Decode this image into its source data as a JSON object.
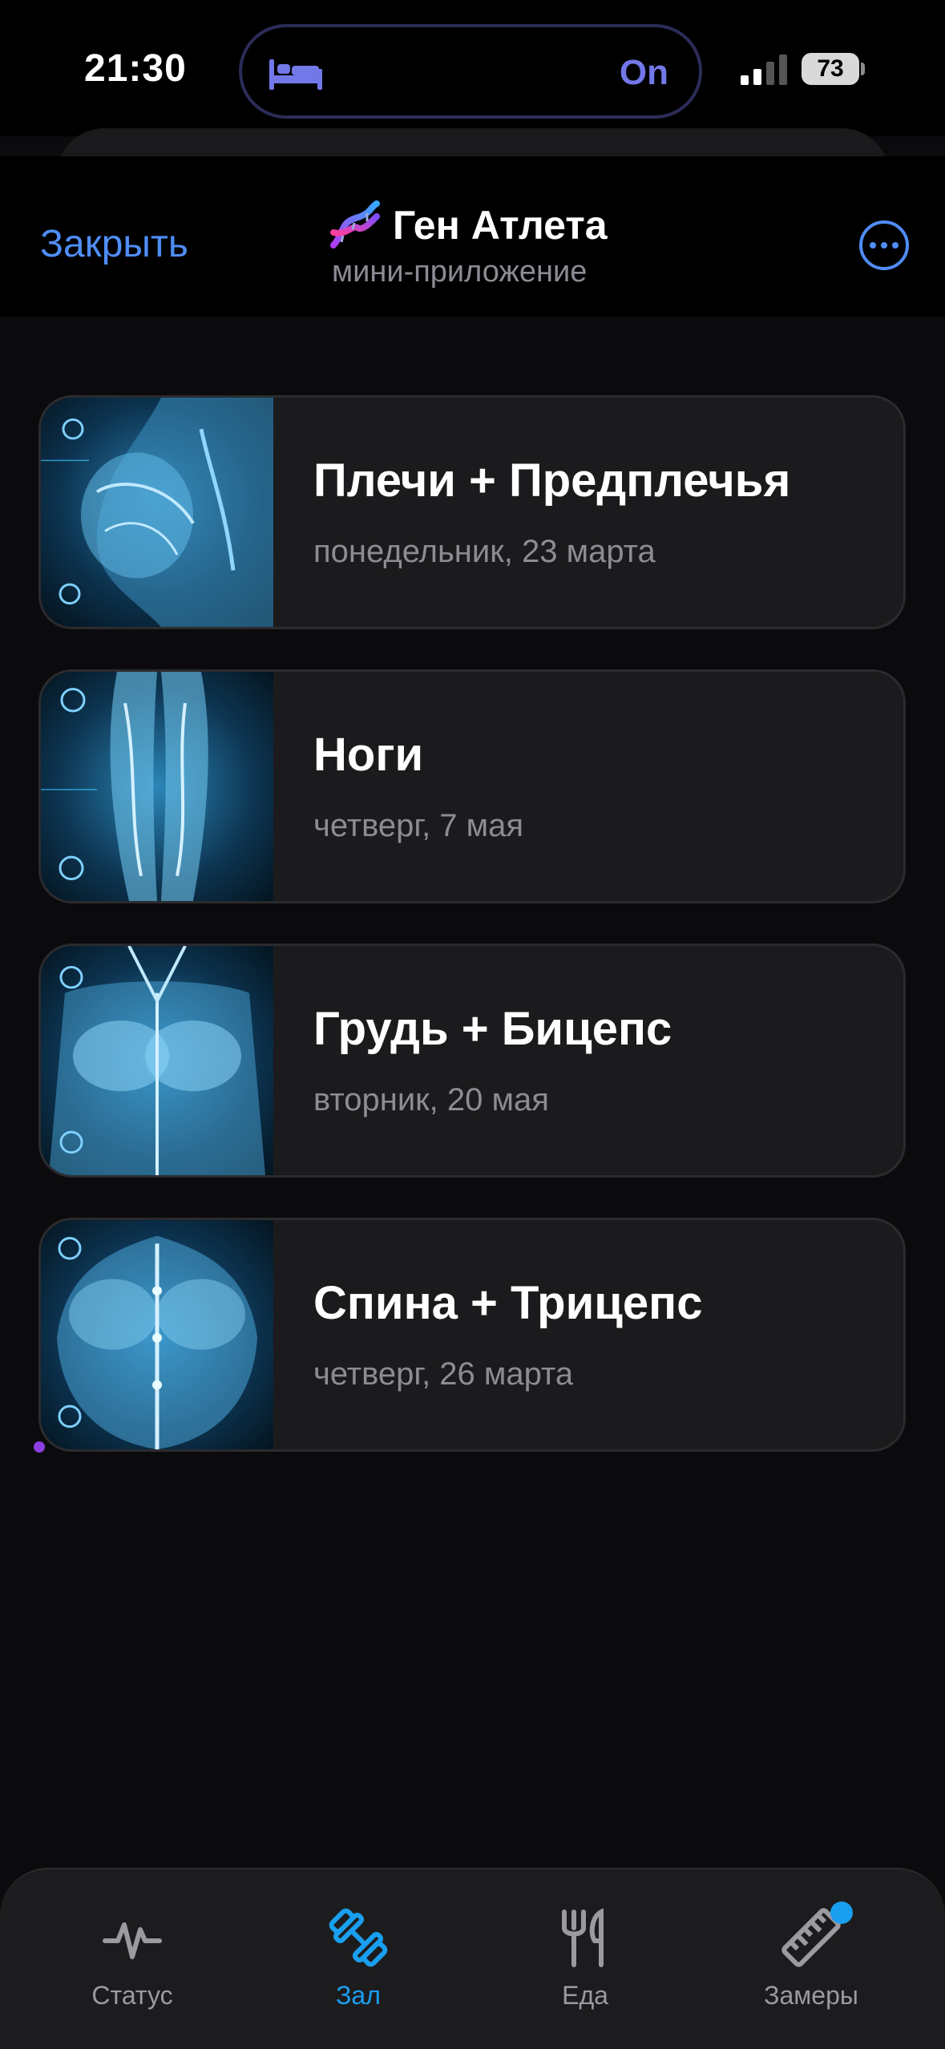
{
  "status_bar": {
    "time": "21:30",
    "focus_status": "On",
    "battery": "73"
  },
  "header": {
    "close_label": "Закрыть",
    "title": "Ген Атлета",
    "subtitle": "мини-приложение"
  },
  "workouts": [
    {
      "title": "Плечи + Предплечья",
      "date": "понедельник, 23 марта",
      "image": "shoulders-illustration"
    },
    {
      "title": "Ноги",
      "date": "четверг, 7 мая",
      "image": "legs-illustration"
    },
    {
      "title": "Грудь + Бицепс",
      "date": "вторник, 20 мая",
      "image": "chest-illustration"
    },
    {
      "title": "Спина + Трицепс",
      "date": "четверг, 26 марта",
      "image": "back-illustration"
    }
  ],
  "tabs": [
    {
      "label": "Статус",
      "icon": "pulse-icon",
      "active": false
    },
    {
      "label": "Зал",
      "icon": "dumbbell-icon",
      "active": true
    },
    {
      "label": "Еда",
      "icon": "fork-knife-icon",
      "active": false
    },
    {
      "label": "Замеры",
      "icon": "ruler-icon",
      "active": false,
      "badge": true
    }
  ],
  "colors": {
    "accent": "#4f8df7",
    "tab_active": "#1a9ff0",
    "island_text": "#7278e8",
    "card_bg": "#1b1b1d",
    "muscle_glow": "#39c6ff"
  }
}
